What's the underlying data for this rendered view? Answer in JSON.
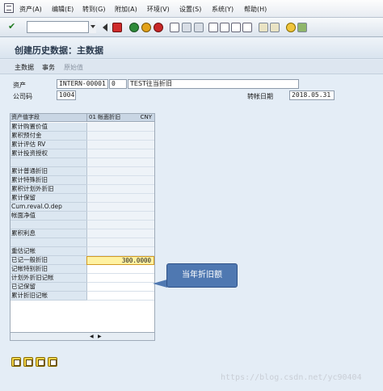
{
  "menubar": {
    "items": [
      "资产(A)",
      "编辑(E)",
      "转到(G)",
      "附加(A)",
      "环境(V)",
      "设置(S)",
      "系统(Y)",
      "帮助(H)"
    ]
  },
  "title": "创建历史数据：主数据",
  "app_toolbar": {
    "items": [
      "主数据",
      "事务",
      "原始值"
    ]
  },
  "fields": {
    "asset_label": "资产",
    "asset_number": "INTERN-00001",
    "asset_sub": "0",
    "asset_desc": "TEST往当折旧",
    "company_label": "公司码",
    "company_code": "1004",
    "transfer_date_label": "转帐日期",
    "transfer_date": "2018.05.31"
  },
  "table": {
    "header_label": "资产值字段",
    "header_area": "01 帐面折旧",
    "header_currency": "CNY",
    "rows": [
      {
        "label": "累计购置价值",
        "value": ""
      },
      {
        "label": "累积预付金",
        "value": ""
      },
      {
        "label": "累计评估 RV",
        "value": ""
      },
      {
        "label": "累计投资授权",
        "value": ""
      },
      {
        "label": "",
        "value": ""
      },
      {
        "label": "累计普通折旧",
        "value": ""
      },
      {
        "label": "累计特殊折旧",
        "value": ""
      },
      {
        "label": "累积计划外折旧",
        "value": ""
      },
      {
        "label": "累计保留",
        "value": ""
      },
      {
        "label": "Cum.reval.O.dep",
        "value": ""
      },
      {
        "label": "帐面净值",
        "value": ""
      },
      {
        "label": "",
        "value": ""
      },
      {
        "label": "累积利息",
        "value": ""
      },
      {
        "label": "",
        "value": ""
      },
      {
        "label": "重估记帐",
        "value": ""
      },
      {
        "label": "已记一般折旧",
        "value": "300.0000"
      },
      {
        "label": "记帐特别折旧",
        "value": ""
      },
      {
        "label": "计划外折旧记帐",
        "value": ""
      },
      {
        "label": "已记保留",
        "value": ""
      },
      {
        "label": "累计折旧记帐",
        "value": ""
      }
    ]
  },
  "callout": "当年折旧额",
  "watermark": "https://blog.csdn.net/yc90404",
  "colors": {
    "highlight_field": "#fff2a2",
    "callout_bg": "#4f78b1",
    "label_column": "#dce7f1"
  }
}
